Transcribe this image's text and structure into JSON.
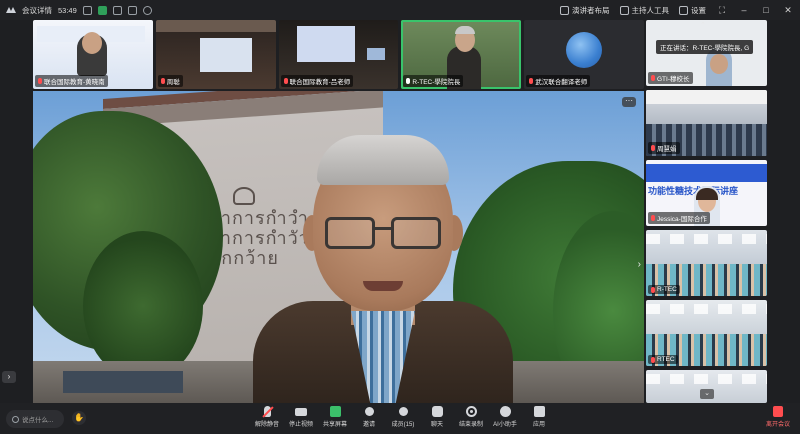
{
  "titlebar": {
    "meeting_details": "会议详情",
    "timer": "53:49",
    "speaker_layout": "演讲者布局",
    "host_tools": "主持人工具",
    "settings": "设置"
  },
  "strip": [
    {
      "name": "联合国际教育-黄晓南",
      "muted": true
    },
    {
      "name": "周聪",
      "muted": true
    },
    {
      "name": "联合国际教育-吕老师",
      "muted": true
    },
    {
      "name": "R-TEC-學院院長",
      "muted": false
    },
    {
      "name": "武汉联合翻译老师",
      "muted": true
    }
  ],
  "right": {
    "speaking_label": "正在讲话：R-TEC-學院院長, G",
    "tiles": [
      {
        "name": "GTI-穆校长"
      },
      {
        "name": "周慧娟"
      },
      {
        "name": "Jessica-国际合作"
      },
      {
        "name": "R-TEC"
      },
      {
        "name": "RTEC"
      }
    ],
    "banner_text": "功能性糖技术国际讲座"
  },
  "main": {
    "building_text": "ภาการกำวำ\nภาการกำวัว\nนักกว้าย"
  },
  "toolbar": {
    "chat_placeholder": "说点什么...",
    "tools": [
      {
        "label": "解除静音",
        "icon": "mic-off-icon"
      },
      {
        "label": "停止视频",
        "icon": "camera-icon"
      },
      {
        "label": "共享屏幕",
        "icon": "share-screen-icon"
      },
      {
        "label": "邀请",
        "icon": "invite-icon"
      },
      {
        "label": "成员(15)",
        "icon": "members-icon"
      },
      {
        "label": "聊天",
        "icon": "chat-icon"
      },
      {
        "label": "结束录制",
        "icon": "record-icon"
      },
      {
        "label": "AI小助手",
        "icon": "ai-assistant-icon"
      },
      {
        "label": "应用",
        "icon": "apps-icon"
      }
    ],
    "leave_label": "离开会议"
  },
  "colors": {
    "active_border": "#39c46b",
    "leave_red": "#ff4d4f",
    "share_green": "#3bbf6a",
    "background": "#1e1f22"
  }
}
